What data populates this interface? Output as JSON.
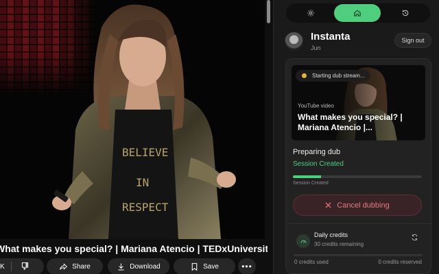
{
  "video": {
    "title": "What makes you special? | Mariana Atencio | TEDxUniversityofNevada",
    "like_count": "K",
    "actions": {
      "share": "Share",
      "download": "Download",
      "save": "Save",
      "more": "•••"
    }
  },
  "extension": {
    "nav": {
      "settings_icon": "gear-icon",
      "home_icon": "home-icon",
      "history_icon": "history-icon",
      "active": "home"
    },
    "profile": {
      "name": "Instanta",
      "subtitle": "Jun",
      "sign_out": "Sign out"
    },
    "thumbnail": {
      "status": "Starting dub stream...",
      "source": "YouTube video",
      "title": "What makes you special? | Mariana Atencio |..."
    },
    "dub": {
      "title": "Preparing dub",
      "status": "Session Created",
      "progress_label": "Session Created",
      "progress_fraction": 0.22,
      "cancel_label": "Cancel dubbing"
    },
    "credits": {
      "title": "Daily credits",
      "remaining": "30 credits remaining",
      "used": "0 credits used",
      "reserved": "0 credits reserved"
    }
  },
  "colors": {
    "accent": "#4fcf7e",
    "danger": "#e87980",
    "status_dot": "#e8b530"
  }
}
